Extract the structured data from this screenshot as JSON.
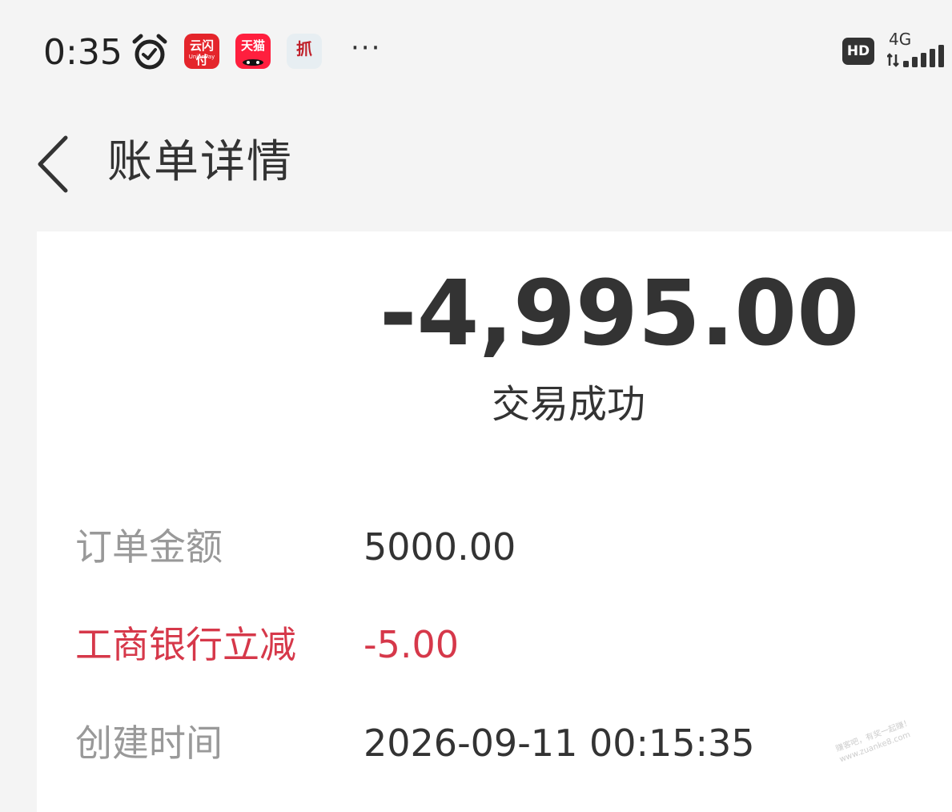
{
  "status_bar": {
    "time": "0:35",
    "icons": [
      "alarm-icon",
      "unionpay-app-icon",
      "tmall-app-icon",
      "third-app-icon"
    ],
    "unionpay_label": "云闪付",
    "unionpay_sub": "UnionPay",
    "tmall_label": "天猫",
    "third_label": "抓",
    "more": "···",
    "hd_badge": "HD",
    "network": "4G"
  },
  "header": {
    "title": "账单详情"
  },
  "bill": {
    "amount": "-4,995.00",
    "status": "交易成功",
    "rows": [
      {
        "label": "订单金额",
        "value": "5000.00"
      },
      {
        "label": "工商银行立减",
        "value": "-5.00"
      },
      {
        "label": "创建时间",
        "value": "2026-09-11 00:15:35"
      }
    ]
  },
  "watermark": {
    "line1": "赚客吧，有奖一起赚！",
    "line2": "www.zuanke8.com"
  },
  "colors": {
    "background": "#f4f4f4",
    "card": "#ffffff",
    "text": "#333333",
    "label_gray": "#999999",
    "discount_red": "#d6384a"
  }
}
